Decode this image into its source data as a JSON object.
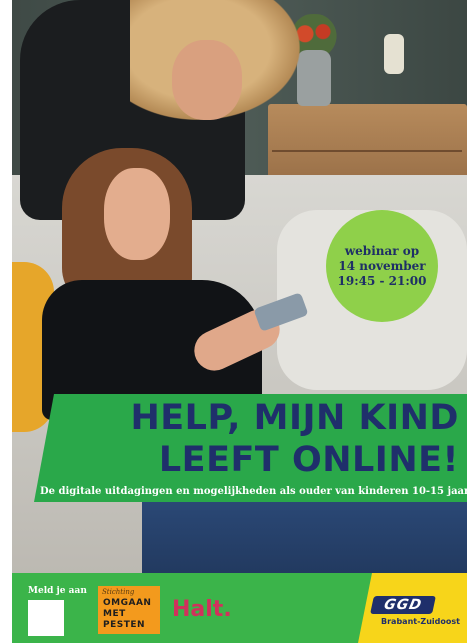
{
  "badge": {
    "line1": "webinar op",
    "line2": "14 november",
    "line3": "19:45 - 21:00"
  },
  "headline": {
    "line1": "HELP, MIJN KIND",
    "line2": "LEEFT ONLINE!"
  },
  "subheadline": "De digitale uitdagingen en mogelijkheden als ouder van kinderen 10-15 jaar",
  "footer": {
    "register_label": "Meld je aan",
    "partner1": {
      "small": "Stichting",
      "line1": "OMGAAN",
      "line2": "MET",
      "line3": "PESTEN"
    },
    "partner2": "Halt.",
    "partner3": {
      "logo": "GGD",
      "region": "Brabant-Zuidoost"
    }
  },
  "colors": {
    "green": "#2aa84a",
    "lime_badge": "#8fd04a",
    "navy": "#1f2f6b",
    "yellow": "#f7d51a",
    "orange": "#f39a1d",
    "pink": "#d1315c"
  }
}
